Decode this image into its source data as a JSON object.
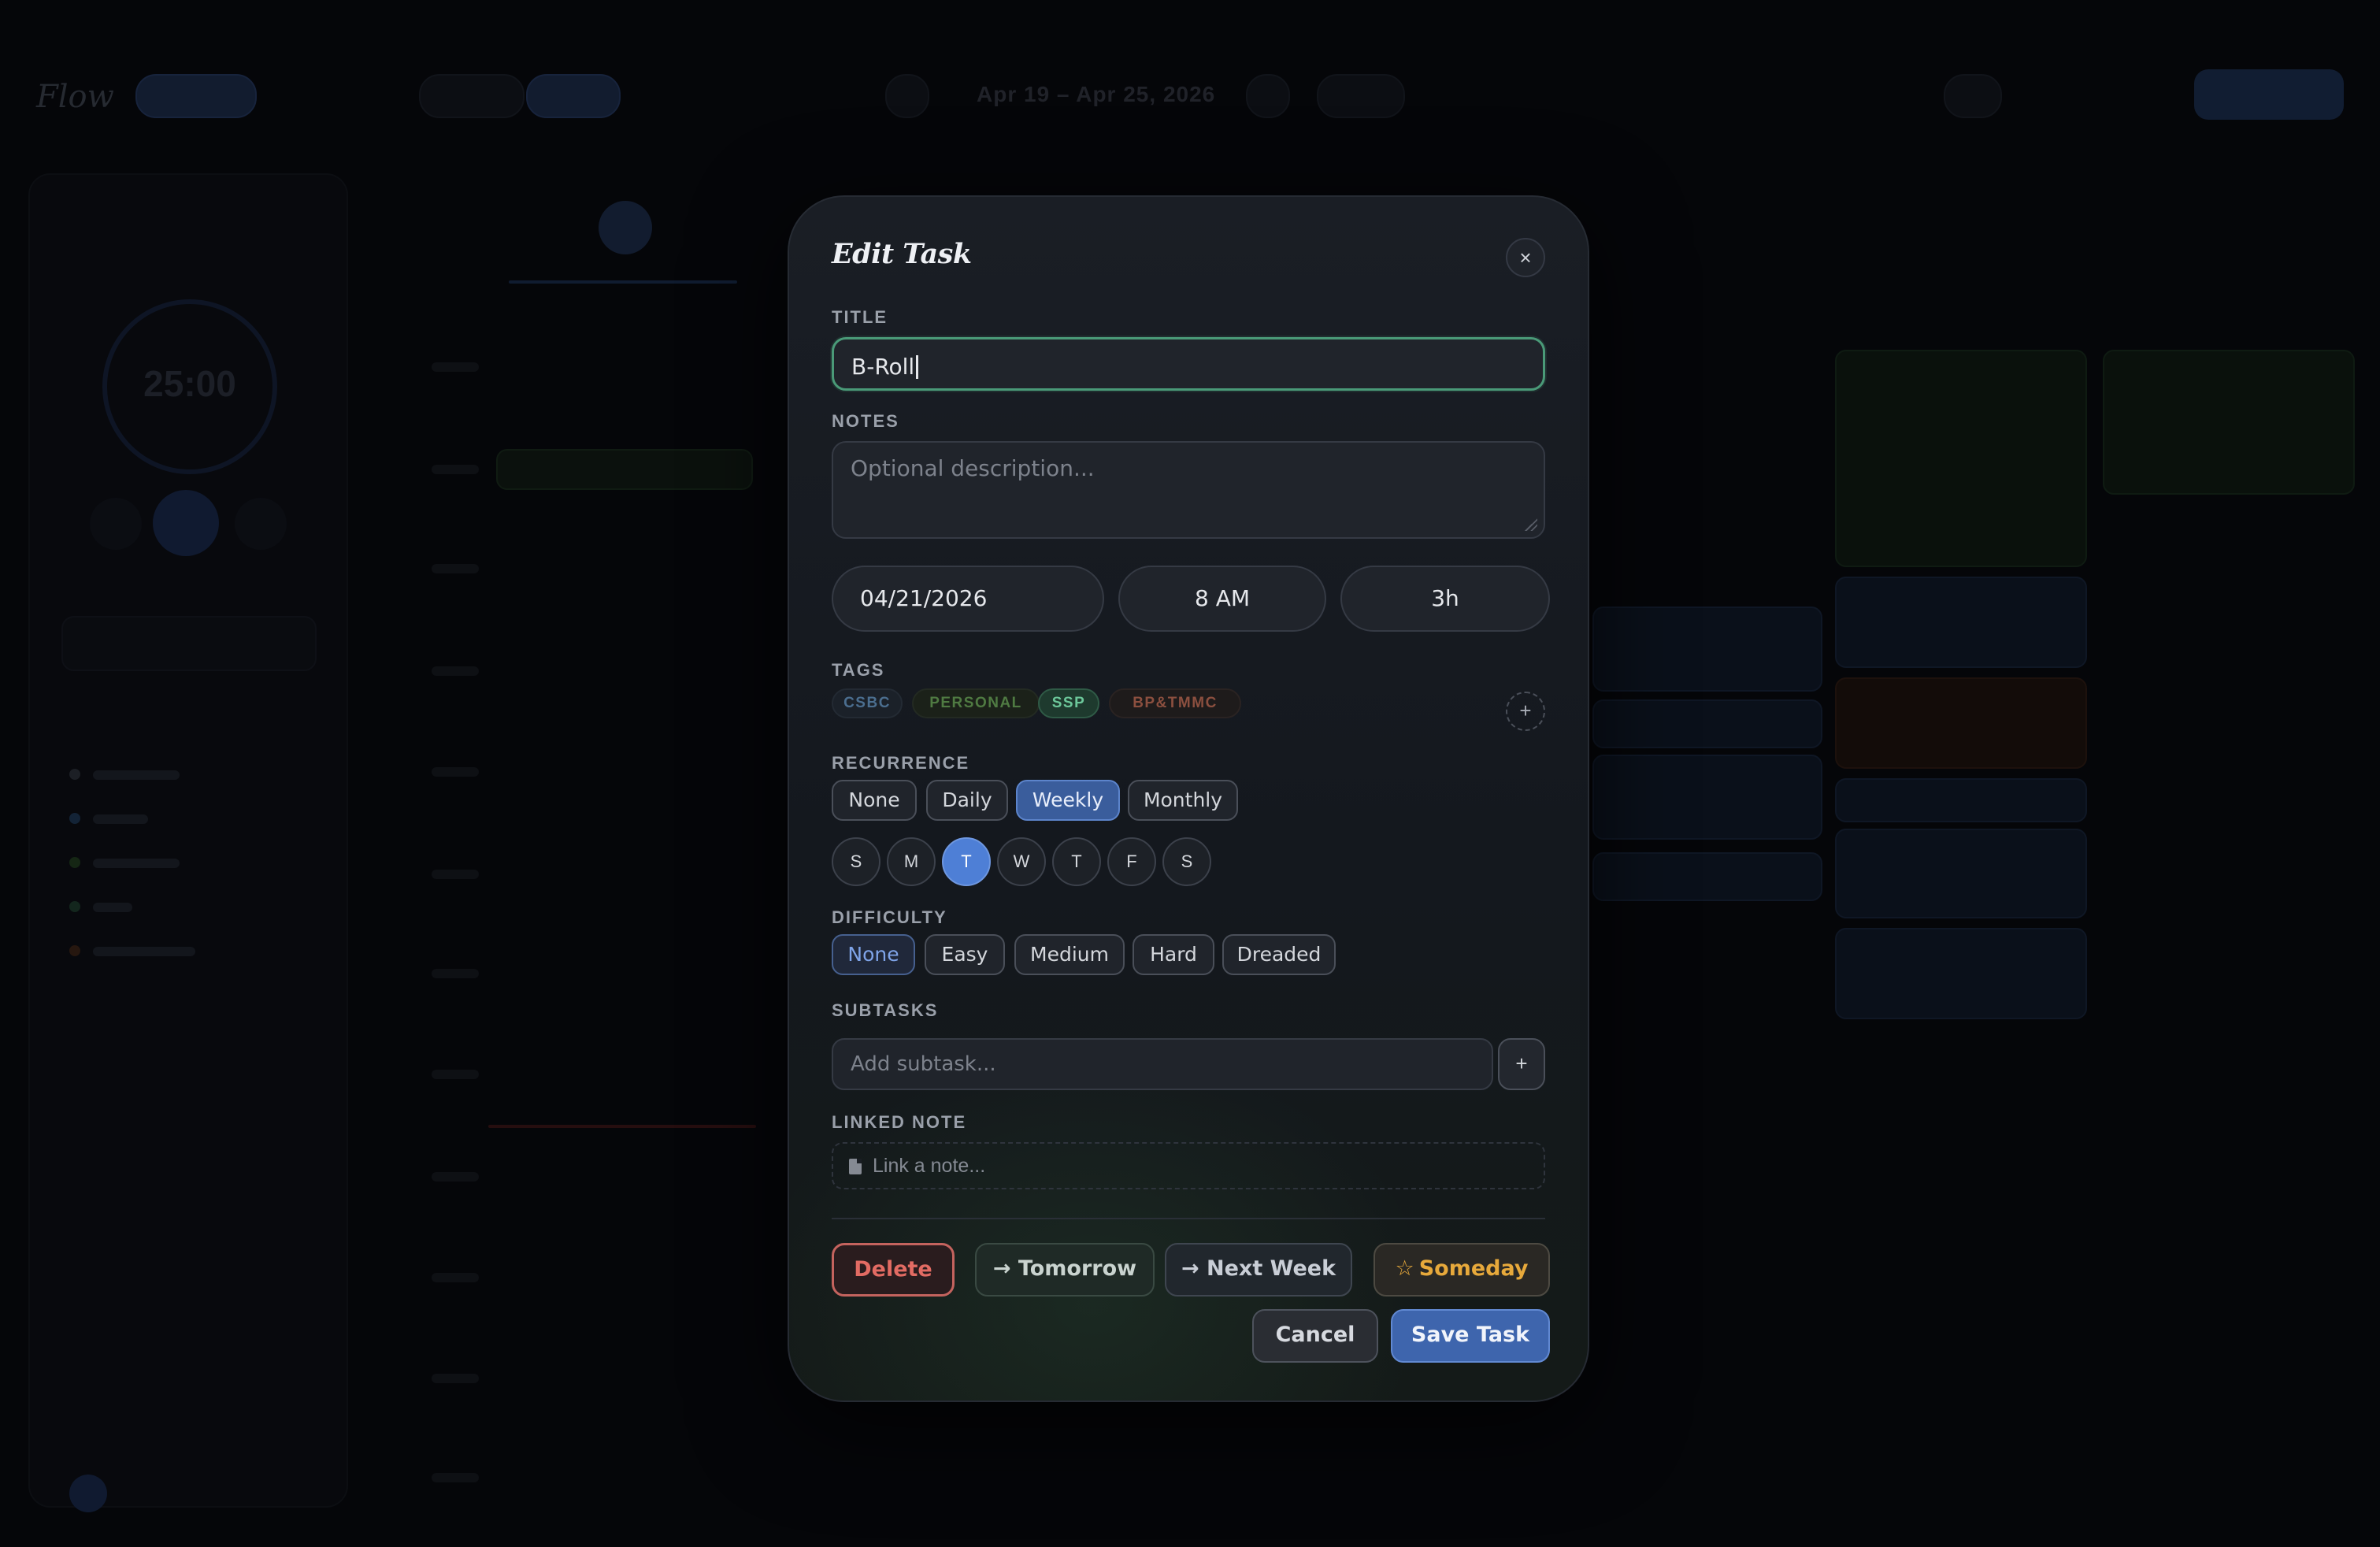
{
  "app": {
    "logo": "Flow",
    "topbar": {
      "date_range": "Apr 19 – Apr 25, 2026"
    },
    "timer": {
      "display": "25:00"
    }
  },
  "modal": {
    "title": "Edit Task",
    "close_label": "×",
    "title_label": "TITLE",
    "title_value": "B-Roll",
    "notes_label": "NOTES",
    "notes_placeholder": "Optional description...",
    "date_value": "04/21/2026",
    "time_value": "8 AM",
    "duration_value": "3h",
    "tags_label": "TAGS",
    "tags": [
      {
        "label": "CSBC",
        "color": "#4b6e8f",
        "selected": false
      },
      {
        "label": "PERSONAL",
        "color": "#4f7a42",
        "selected": false
      },
      {
        "label": "SSP",
        "color": "#6cc79a",
        "selected": true
      },
      {
        "label": "BP&TMMC",
        "color": "#8b4f3f",
        "selected": false
      }
    ],
    "tag_add_label": "+",
    "recurrence_label": "RECURRENCE",
    "recurrence_options": [
      "None",
      "Daily",
      "Weekly",
      "Monthly"
    ],
    "recurrence_selected": "Weekly",
    "weekdays": [
      "S",
      "M",
      "T",
      "W",
      "T",
      "F",
      "S"
    ],
    "weekday_selected_index": 2,
    "difficulty_label": "DIFFICULTY",
    "difficulty_options": [
      "None",
      "Easy",
      "Medium",
      "Hard",
      "Dreaded"
    ],
    "difficulty_selected": "None",
    "subtasks_label": "SUBTASKS",
    "subtask_placeholder": "Add subtask...",
    "subtask_add_label": "+",
    "linked_note_label": "LINKED NOTE",
    "linked_note_placeholder": "Link a note...",
    "actions": {
      "delete": "Delete",
      "tomorrow": "→ Tomorrow",
      "next_week": "→ Next Week",
      "someday": "Someday",
      "someday_icon": "☆",
      "cancel": "Cancel",
      "save": "Save Task"
    },
    "colors": {
      "accent_blue": "#4e7fd6",
      "focus_green": "#4a9a78",
      "delete_red": "#e26b63",
      "someday_gold": "#e7a93b"
    }
  }
}
